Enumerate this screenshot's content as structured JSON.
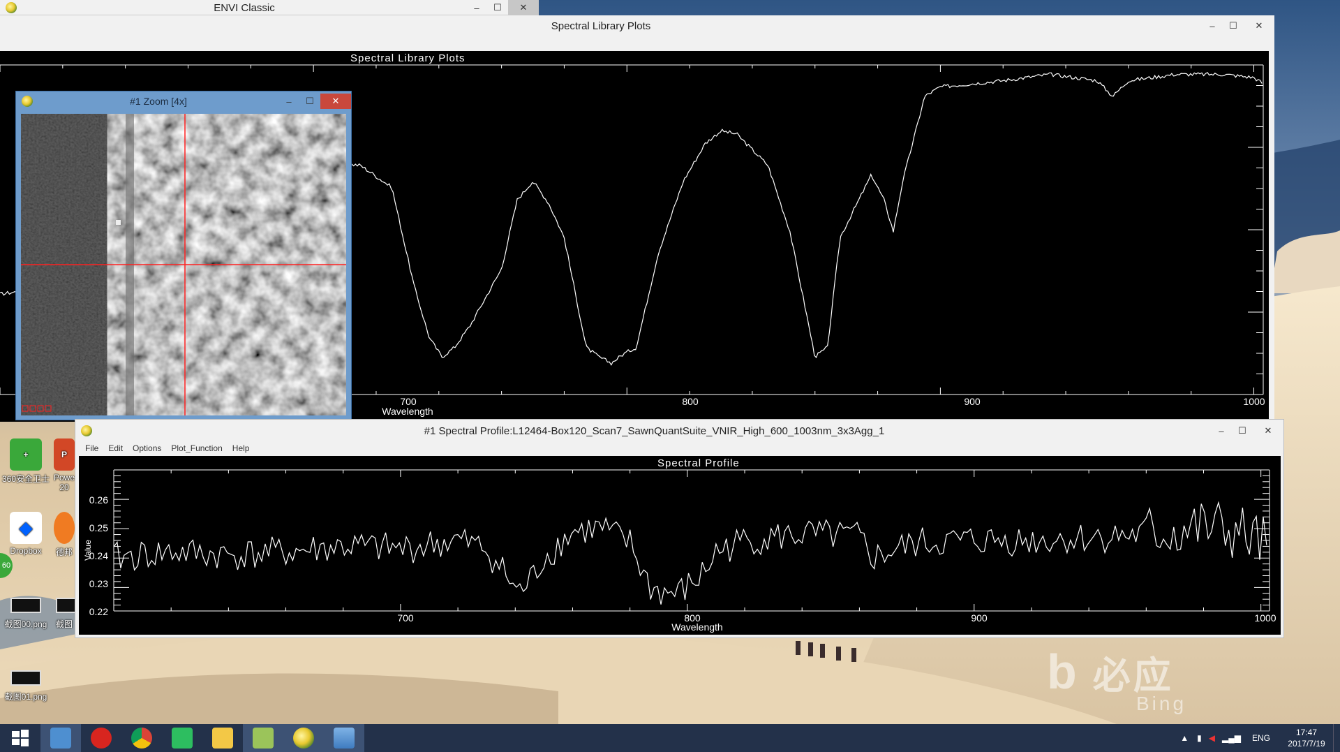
{
  "envi_classic": {
    "title": "ENVI Classic"
  },
  "library_window": {
    "title": "Spectral Library Plots",
    "plot_title": "Spectral Library Plots",
    "xlabel": "Wavelength",
    "x_ticks": [
      "700",
      "800",
      "900",
      "1000"
    ]
  },
  "zoom_window": {
    "title": "#1 Zoom [4x]"
  },
  "profile_window": {
    "title": "#1 Spectral Profile:L12464-Box120_Scan7_SawnQuantSuite_VNIR_High_600_1003nm_3x3Agg_1",
    "menu": [
      "File",
      "Edit",
      "Options",
      "Plot_Function",
      "Help"
    ],
    "plot_title": "Spectral Profile",
    "xlabel": "Wavelength",
    "ylabel": "Value",
    "x_ticks": [
      "700",
      "800",
      "900",
      "1000"
    ],
    "y_ticks": [
      "0.26",
      "0.25",
      "0.24",
      "0.23",
      "0.22"
    ]
  },
  "desktop_icons": [
    {
      "label": "360安全卫士",
      "icon": "360-security-icon",
      "color": "#3aa83a"
    },
    {
      "label": "Powe\n20",
      "icon": "powerpoint-icon",
      "color": "#d24726"
    },
    {
      "label": "Dropbox",
      "icon": "dropbox-icon",
      "color": "#0061fe"
    },
    {
      "label": "德邦",
      "icon": "app-icon",
      "color": "#f07b22"
    },
    {
      "label": "截图00.png",
      "icon": "image-file-icon",
      "color": "#222"
    },
    {
      "label": "截图",
      "icon": "image-file-icon",
      "color": "#222"
    },
    {
      "label": "截图01.png",
      "icon": "image-file-icon",
      "color": "#222"
    }
  ],
  "bing_watermark": {
    "text": "必应",
    "subtext": "Bing"
  },
  "taskbar": {
    "apps": [
      "start-icon",
      "control-panel-icon",
      "netease-music-icon",
      "chrome-icon",
      "evernote-icon",
      "file-explorer-icon",
      "notepad-icon",
      "envi-icon",
      "photos-icon"
    ],
    "language": "ENG",
    "time": "17:47",
    "date": "2017/7/19"
  },
  "chart_data": [
    {
      "type": "line",
      "title": "Spectral Library Plots",
      "xlabel": "Wavelength",
      "xlim": [
        600,
        1003
      ],
      "x_ticks": [
        700,
        800,
        900,
        1000
      ],
      "x": [
        600,
        615,
        630,
        645,
        660,
        675,
        685,
        695,
        705,
        715,
        725,
        732,
        737,
        741,
        745,
        750,
        760,
        765,
        770,
        775,
        780,
        787,
        791,
        795,
        799,
        803,
        810,
        818,
        825,
        830,
        835,
        840,
        845,
        852,
        860,
        864,
        868,
        873,
        878,
        882,
        885,
        888,
        895,
        900,
        910,
        920,
        935,
        950,
        955,
        960,
        975,
        990,
        1000,
        1003
      ],
      "y": [
        0.32,
        0.34,
        0.38,
        0.47,
        0.6,
        0.58,
        0.62,
        0.7,
        0.74,
        0.73,
        0.66,
        0.35,
        0.18,
        0.12,
        0.15,
        0.22,
        0.4,
        0.62,
        0.68,
        0.61,
        0.5,
        0.15,
        0.12,
        0.1,
        0.13,
        0.15,
        0.45,
        0.68,
        0.8,
        0.84,
        0.83,
        0.78,
        0.73,
        0.52,
        0.12,
        0.15,
        0.5,
        0.6,
        0.7,
        0.62,
        0.52,
        0.68,
        0.95,
        0.98,
        0.99,
        1.0,
        1.02,
        1.0,
        0.95,
        1.0,
        1.02,
        1.02,
        1.01,
        0.99
      ],
      "ylim": [
        0,
        1.05
      ]
    },
    {
      "type": "line",
      "title": "Spectral Profile",
      "xlabel": "Wavelength",
      "ylabel": "Value",
      "xlim": [
        600,
        1003
      ],
      "ylim": [
        0.22,
        0.268
      ],
      "x_ticks": [
        700,
        800,
        900,
        1000
      ],
      "y_ticks": [
        0.22,
        0.23,
        0.24,
        0.25,
        0.26
      ],
      "x": [
        600,
        620,
        640,
        660,
        680,
        700,
        720,
        730,
        737,
        741,
        745,
        750,
        760,
        770,
        780,
        787,
        792,
        797,
        800,
        805,
        810,
        820,
        840,
        860,
        865,
        870,
        880,
        900,
        920,
        940,
        960,
        980,
        990,
        1000,
        1003
      ],
      "y": [
        0.238,
        0.24,
        0.239,
        0.24,
        0.242,
        0.241,
        0.244,
        0.241,
        0.232,
        0.226,
        0.23,
        0.238,
        0.247,
        0.248,
        0.243,
        0.228,
        0.226,
        0.226,
        0.228,
        0.232,
        0.24,
        0.244,
        0.246,
        0.245,
        0.238,
        0.24,
        0.243,
        0.244,
        0.244,
        0.245,
        0.246,
        0.248,
        0.247,
        0.243,
        0.24
      ]
    }
  ]
}
